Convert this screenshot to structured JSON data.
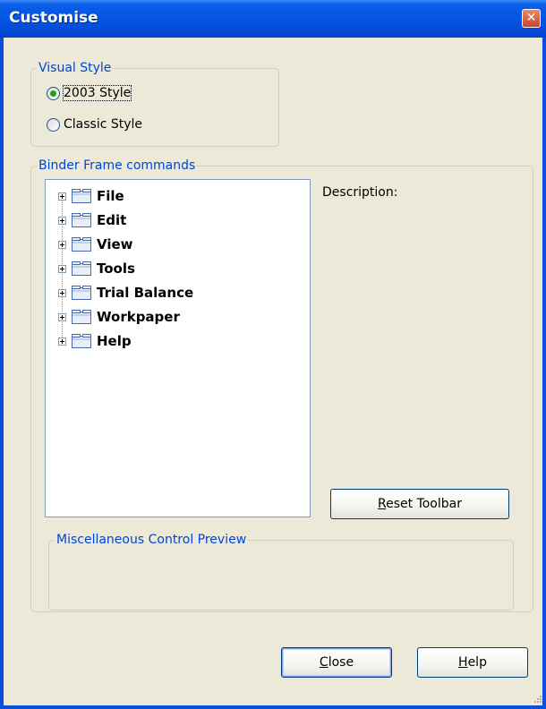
{
  "window": {
    "title": "Customise",
    "close_glyph": "✕"
  },
  "visual_style": {
    "legend": "Visual Style",
    "options": [
      {
        "label": "2003 Style",
        "checked": true
      },
      {
        "label": "Classic Style",
        "checked": false
      }
    ]
  },
  "binder_frame": {
    "legend": "Binder Frame commands",
    "tree_items": [
      "File",
      "Edit",
      "View",
      "Tools",
      "Trial Balance",
      "Workpaper",
      "Help"
    ],
    "description_label": "Description:",
    "reset_button": "Reset Toolbar"
  },
  "misc_preview": {
    "legend": "Miscellaneous Control Preview"
  },
  "footer": {
    "close_button": "Close",
    "help_button": "Help"
  },
  "colors": {
    "titlebar": "#0554e2",
    "legend_text": "#0046d5",
    "dialog_bg": "#ece9d8"
  }
}
